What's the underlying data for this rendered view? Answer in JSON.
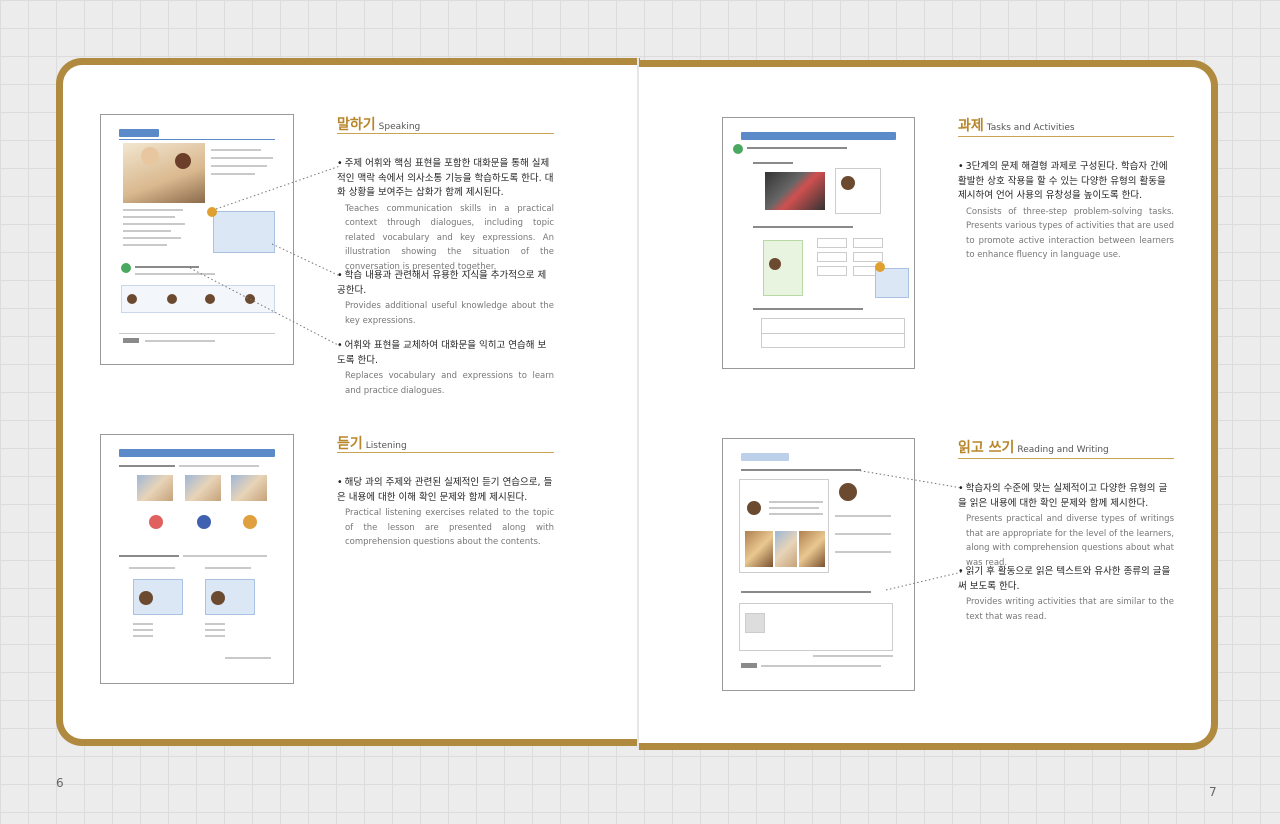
{
  "page_numbers": {
    "left": "6",
    "right": "7"
  },
  "colors": {
    "frame": "#b08a3e",
    "heading": "#b8862b",
    "thumb_bar": "#5a8ac8"
  },
  "sections": {
    "speaking": {
      "title_ko": "말하기",
      "title_en": "Speaking",
      "items": [
        {
          "ko": "주제 어휘와 핵심 표현을 포함한 대화문을 통해 실제적인 맥락 속에서 의사소통 기능을 학습하도록 한다. 대화 상황을 보여주는 삽화가 함께 제시된다.",
          "en": "Teaches communication skills in a practical context through dialogues, including topic related vocabulary and key expressions. An illustration showing the situation of the conversation is presented together."
        },
        {
          "ko": "학습 내용과 관련해서 유용한 지식을 추가적으로 제공한다.",
          "en": "Provides additional useful knowledge about the key expressions."
        },
        {
          "ko": "어휘와 표현을 교체하여 대화문을 익히고 연습해 보도록 한다.",
          "en": "Replaces vocabulary and expressions to learn and practice dialogues."
        }
      ]
    },
    "listening": {
      "title_ko": "듣기",
      "title_en": "Listening",
      "items": [
        {
          "ko": "해당 과의 주제와 관련된 실제적인 듣기 연습으로, 들은 내용에 대한 이해 확인 문제와 함께 제시된다.",
          "en": "Practical listening exercises related to the topic of the lesson are presented along with comprehension questions about the contents."
        }
      ]
    },
    "tasks": {
      "title_ko": "과제",
      "title_en": "Tasks and Activities",
      "items": [
        {
          "ko": "3단계의 문제 해결형 과제로 구성된다. 학습자 간에 활발한 상호 작용을 할 수 있는 다양한 유형의 활동을 제시하여 언어 사용의 유창성을 높이도록 한다.",
          "en": "Consists of three-step problem-solving tasks. Presents various types of activities that are used to promote active interaction between learners to enhance fluency in language use."
        }
      ]
    },
    "reading": {
      "title_ko": "읽고 쓰기",
      "title_en": "Reading and Writing",
      "items": [
        {
          "ko": "학습자의 수준에 맞는 실제적이고 다양한 유형의 글을 읽은 내용에 대한 확인 문제와 함께 제시한다.",
          "en": "Presents practical and diverse types of writings that are appropriate for the level of the learners, along with comprehension questions about what was read."
        },
        {
          "ko": "읽기 후 활동으로 읽은 텍스트와 유사한 종류의 글을 써 보도록 한다.",
          "en": "Provides writing activities that are similar to the text that was read."
        }
      ]
    }
  }
}
